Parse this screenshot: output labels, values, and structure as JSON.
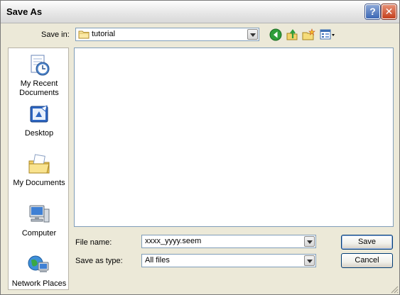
{
  "window": {
    "title": "Save As"
  },
  "titlebar": {
    "help_glyph": "?",
    "close_glyph": "✕"
  },
  "toolbar": {
    "save_in_label": "Save in:",
    "save_in_value": "tutorial",
    "icons": [
      "back-icon",
      "up-folder-icon",
      "new-folder-icon",
      "view-menu-icon"
    ]
  },
  "places": [
    {
      "label": "My Recent Documents",
      "icon": "recent-documents-icon"
    },
    {
      "label": "Desktop",
      "icon": "desktop-icon"
    },
    {
      "label": "My Documents",
      "icon": "my-documents-icon"
    },
    {
      "label": "Computer",
      "icon": "computer-icon"
    },
    {
      "label": "Network Places",
      "icon": "network-places-icon"
    }
  ],
  "form": {
    "file_name_label": "File name:",
    "file_name_value": "xxxx_yyyy.seem",
    "save_type_label": "Save as type:",
    "save_type_value": "All files"
  },
  "buttons": {
    "save": "Save",
    "cancel": "Cancel"
  },
  "colors": {
    "dialog_bg": "#ece9d8",
    "accent": "#003c74",
    "field_border": "#7f9db9"
  }
}
